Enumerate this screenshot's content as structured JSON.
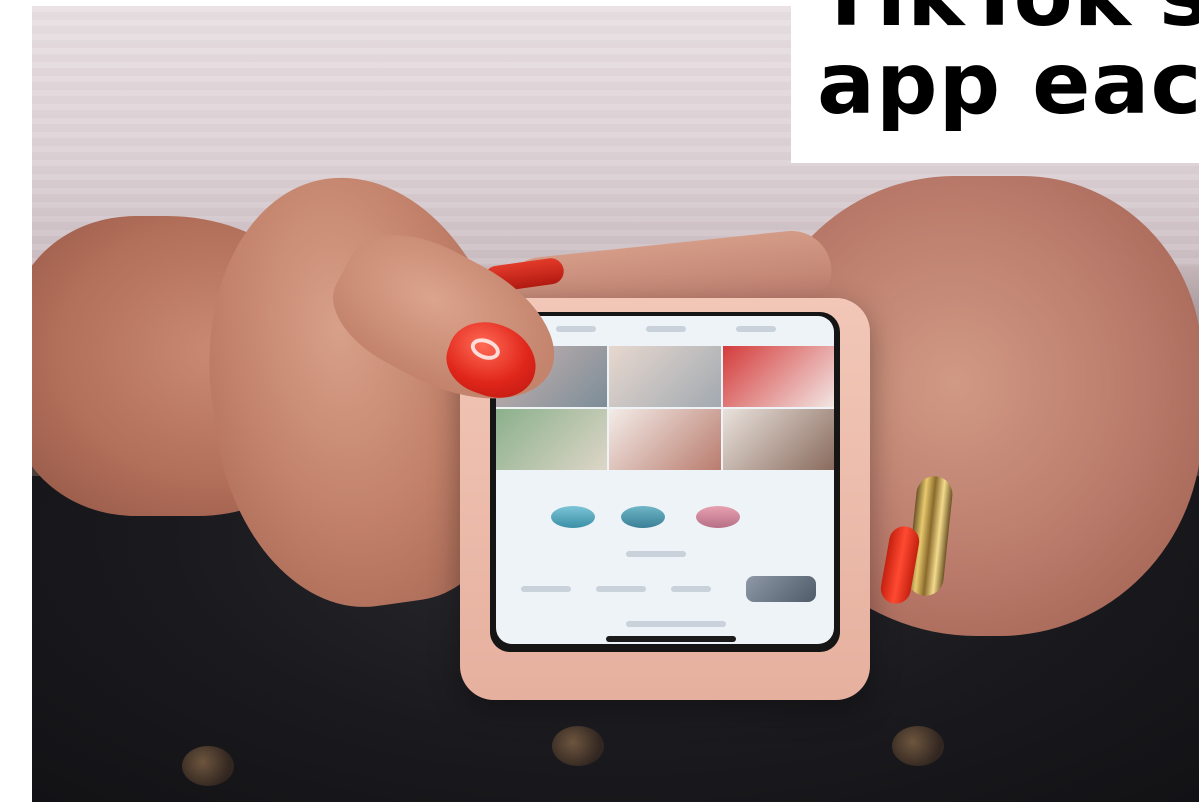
{
  "headline": {
    "line1": "TikTok's",
    "line2": "app eacl"
  },
  "photo": {
    "subject": "hands-holding-smartphone",
    "nail_color": "#e0261b",
    "phone_case_color": "#f2c7b8"
  }
}
